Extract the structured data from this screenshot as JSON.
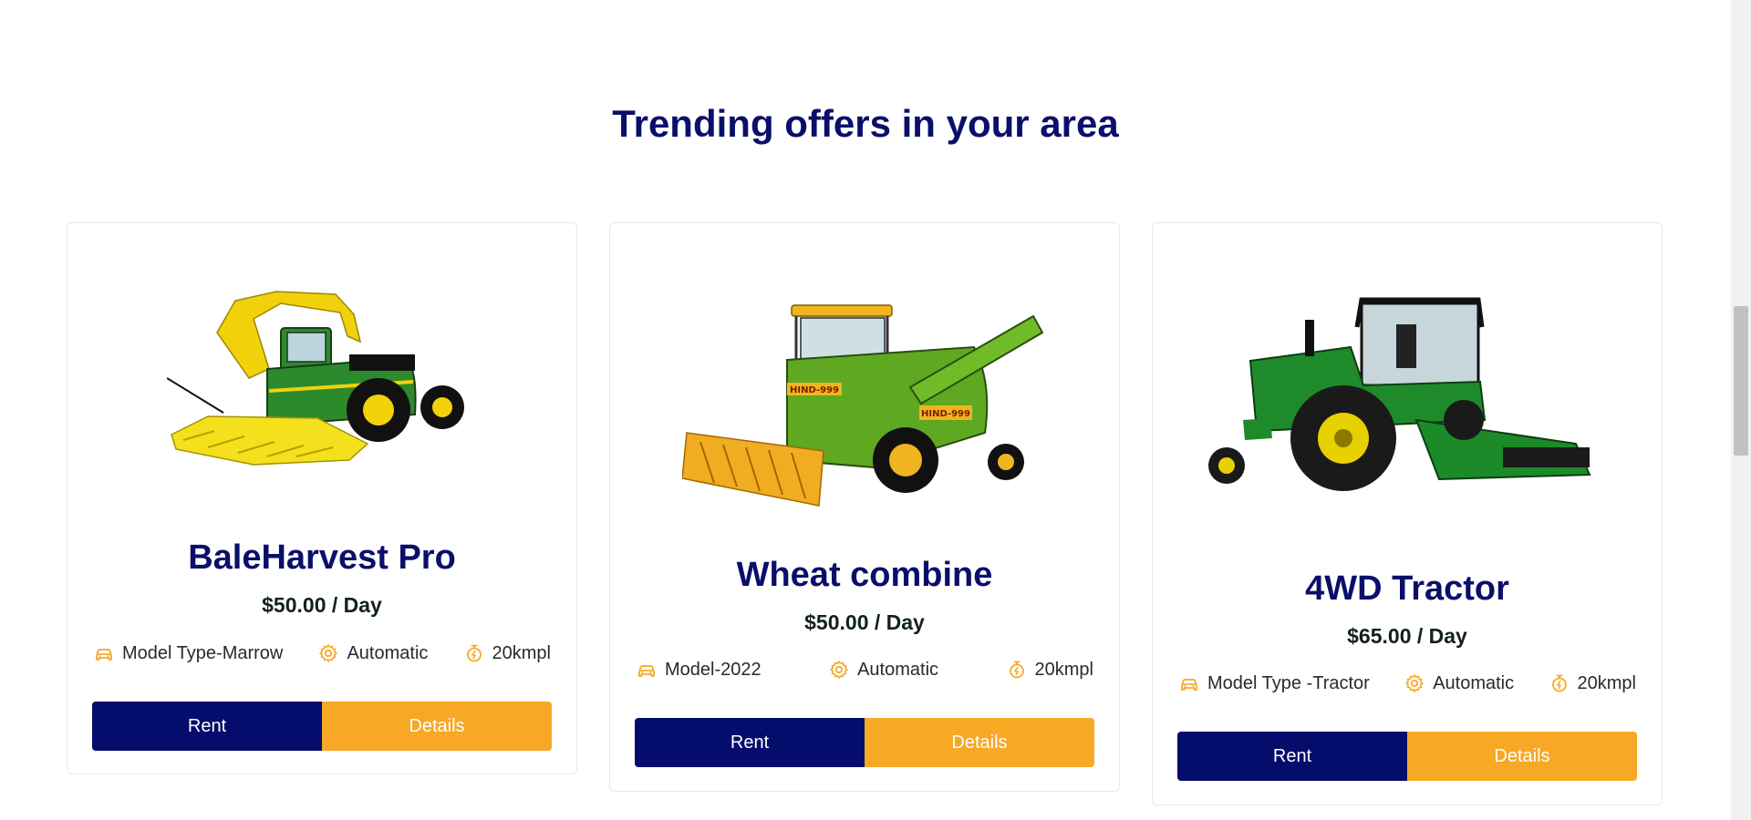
{
  "section": {
    "title": "Trending offers in your area"
  },
  "colors": {
    "primary": "#040d6b",
    "accent": "#f7a825",
    "title": "#0a0f6a"
  },
  "cards": [
    {
      "name": "BaleHarvest Pro",
      "price": "$50.00 / Day",
      "specs": [
        {
          "icon": "car-icon",
          "text": "Model Type-Marrow"
        },
        {
          "icon": "gear-icon",
          "text": "Automatic"
        },
        {
          "icon": "stopwatch-icon",
          "text": "20kmpl"
        }
      ],
      "rent_label": "Rent",
      "details_label": "Details"
    },
    {
      "name": "Wheat combine",
      "price": "$50.00 / Day",
      "specs": [
        {
          "icon": "car-icon",
          "text": "Model-2022"
        },
        {
          "icon": "gear-icon",
          "text": "Automatic"
        },
        {
          "icon": "stopwatch-icon",
          "text": "20kmpl"
        }
      ],
      "rent_label": "Rent",
      "details_label": "Details"
    },
    {
      "name": "4WD Tractor",
      "price": "$65.00 / Day",
      "specs": [
        {
          "icon": "car-icon",
          "text": "Model Type -Tractor"
        },
        {
          "icon": "gear-icon",
          "text": "Automatic"
        },
        {
          "icon": "stopwatch-icon",
          "text": "20kmpl"
        }
      ],
      "rent_label": "Rent",
      "details_label": "Details"
    }
  ]
}
